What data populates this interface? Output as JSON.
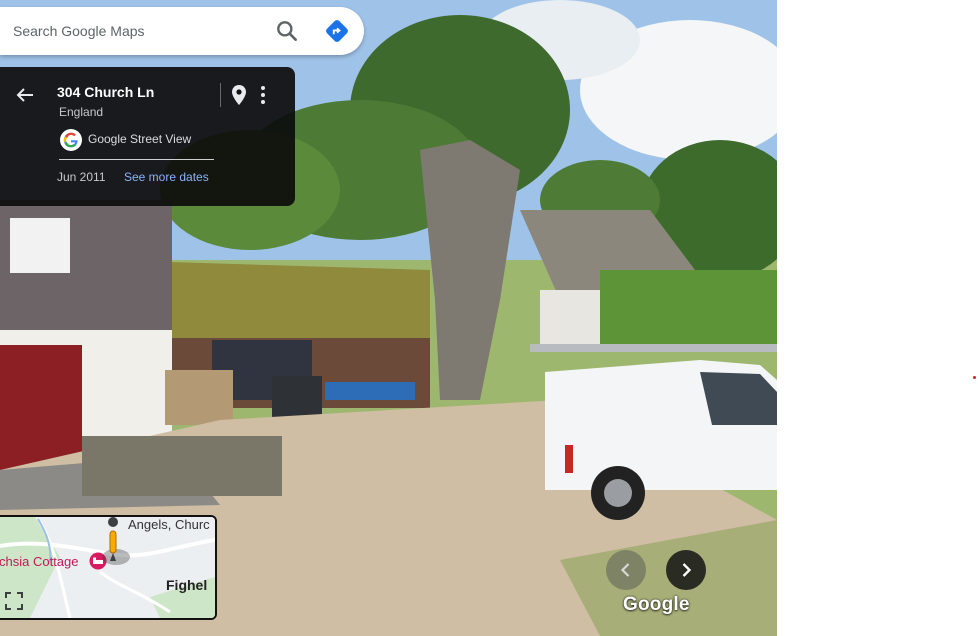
{
  "search": {
    "placeholder": "Search Google Maps",
    "search_icon": "search-icon",
    "directions_icon": "directions-icon"
  },
  "place_card": {
    "title": "304 Church Ln",
    "subtitle": "England",
    "source": "Google Street View",
    "capture_date": "Jun 2011",
    "see_more_dates": "See more dates",
    "icons": [
      "back-arrow-icon",
      "location-pin-icon",
      "more-vert-icon",
      "google-logo-icon"
    ]
  },
  "minimap": {
    "labels": {
      "angels": "Angels, Churc",
      "cottage": "chsia Cottage",
      "village": "Fighel"
    },
    "icons": [
      "pegman-icon",
      "hotel-marker-icon",
      "expand-icon"
    ]
  },
  "navigation": {
    "prev_icon": "chevron-left-icon",
    "next_icon": "chevron-right-icon"
  },
  "wordmark": "Google",
  "colors": {
    "accent": "#1a73e8",
    "link": "#8ab4f8",
    "card_bg": "#0c0c0c",
    "hotel_marker": "#d81b60",
    "pegman": "#f9ab00"
  }
}
